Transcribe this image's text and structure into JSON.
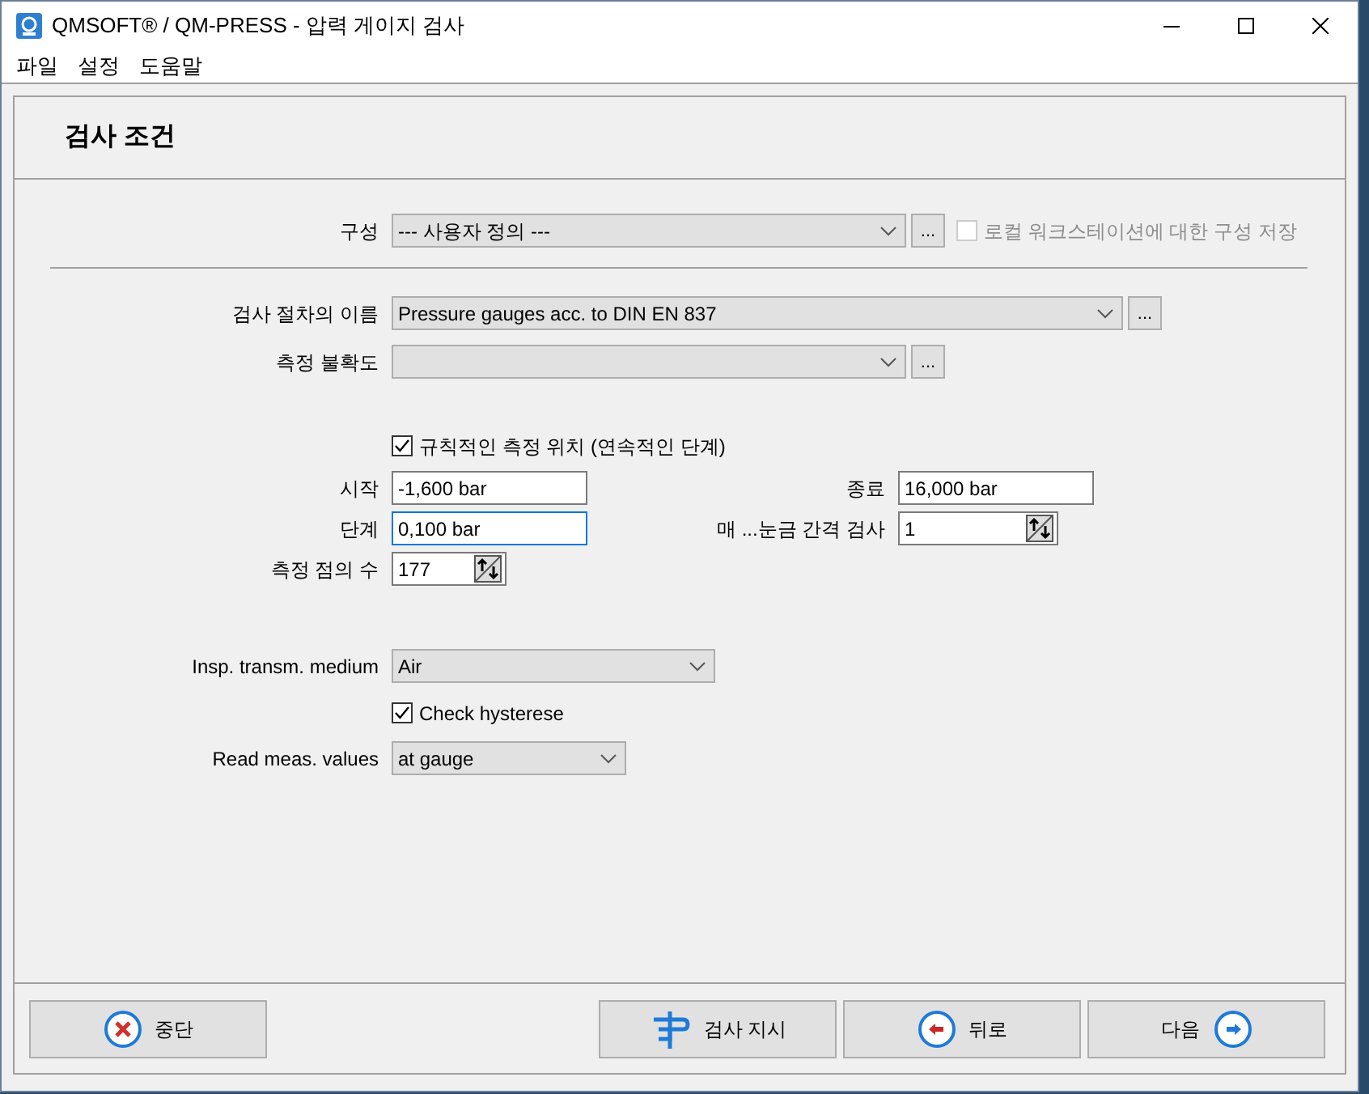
{
  "window": {
    "title": "QMSOFT® / QM-PRESS - 압력 게이지 검사"
  },
  "menu": [
    "파일",
    "설정",
    "도움말"
  ],
  "section_title": "검사 조건",
  "configuration": {
    "label": "구성",
    "value": "--- 사용자 정의 ---",
    "browse": "...",
    "save_checkbox": {
      "label": "로컬 워크스테이션에 대한 구성 저장",
      "checked": false,
      "disabled": true
    }
  },
  "procedure": {
    "label": "검사 절차의 이름",
    "value": "Pressure gauges acc. to DIN EN 837",
    "browse": "..."
  },
  "uncertainty": {
    "label": "측정 불확도",
    "browse": "..."
  },
  "regular_positions": {
    "label": "규칙적인 측정 위치 (연속적인 단계)",
    "checked": true
  },
  "start": {
    "label": "시작",
    "value": "-1,600 bar"
  },
  "end": {
    "label": "종료",
    "value": "16,000 bar"
  },
  "step": {
    "label": "단계",
    "value": "0,100 bar",
    "focused": true
  },
  "interval": {
    "label": "매 ...눈금 간격 검사",
    "value": "1"
  },
  "points": {
    "label": "측정 점의 수",
    "value": "177"
  },
  "medium": {
    "label": "Insp. transm. medium",
    "value": "Air"
  },
  "hysteresis": {
    "label": "Check hysterese",
    "checked": true
  },
  "read_values": {
    "label": "Read meas. values",
    "value": "at gauge"
  },
  "buttons": [
    {
      "kind": "cancel",
      "label": "중단"
    },
    {
      "kind": "instruction",
      "label": "검사 지시"
    },
    {
      "kind": "back",
      "label": "뒤로"
    },
    {
      "kind": "next",
      "label": "다음"
    }
  ]
}
